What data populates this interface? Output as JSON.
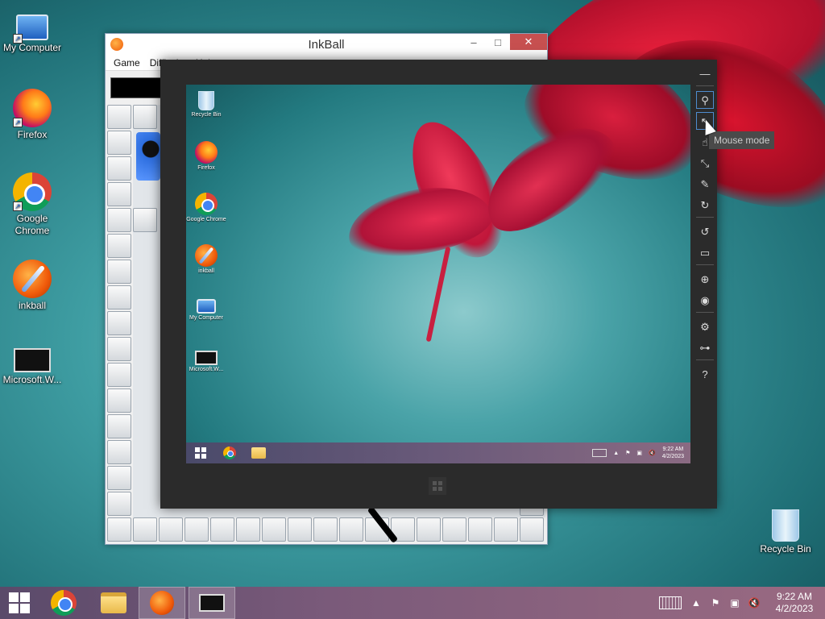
{
  "desktop": {
    "icons": [
      {
        "label": "My Computer",
        "icon": "computer-icon"
      },
      {
        "label": "Firefox",
        "icon": "firefox-icon"
      },
      {
        "label": "Google Chrome",
        "icon": "chrome-icon"
      },
      {
        "label": "inkball",
        "icon": "inkball-icon"
      },
      {
        "label": "Microsoft.W...",
        "icon": "remote-desktop-icon"
      },
      {
        "label": "Recycle Bin",
        "icon": "recycle-bin-icon"
      }
    ]
  },
  "inkball": {
    "title": "InkBall",
    "menu": [
      "Game",
      "Difficulty",
      "Help"
    ],
    "controls": {
      "minimize": "–",
      "maximize": "□",
      "close": "✕"
    }
  },
  "viewer": {
    "tooltip": "Mouse mode",
    "toolbar": [
      {
        "name": "minimize",
        "glyph": "—"
      },
      {
        "name": "pin",
        "glyph": "⚲"
      },
      {
        "name": "mouse-mode",
        "glyph": "↖"
      },
      {
        "name": "touch-mode",
        "glyph": "☝"
      },
      {
        "name": "zoom-mode",
        "glyph": "⤡"
      },
      {
        "name": "pen-mode",
        "glyph": "✎"
      },
      {
        "name": "rotate-right",
        "glyph": "↻"
      },
      {
        "name": "rotate-left",
        "glyph": "↺"
      },
      {
        "name": "display",
        "glyph": "▭"
      },
      {
        "name": "network",
        "glyph": "⊕"
      },
      {
        "name": "screenshot",
        "glyph": "◉"
      },
      {
        "name": "settings",
        "glyph": "⚙"
      },
      {
        "name": "connection",
        "glyph": "⊶"
      },
      {
        "name": "help",
        "glyph": "?"
      }
    ],
    "remote_desktop": {
      "icons": [
        "Recycle Bin",
        "Firefox",
        "Google Chrome",
        "inkball",
        "My Computer",
        "Microsoft.W..."
      ],
      "clock_time": "9:22 AM",
      "clock_date": "4/2/2023"
    }
  },
  "taskbar": {
    "clock_time": "9:22 AM",
    "clock_date": "4/2/2023",
    "tray_glyphs": {
      "arrow": "▲",
      "flag": "⚑",
      "network": "▣",
      "volume": "🔇"
    }
  },
  "colors": {
    "close_button": "#c75050",
    "viewer_frame": "#2b2b2b",
    "active_outline": "#4f8ccf"
  }
}
